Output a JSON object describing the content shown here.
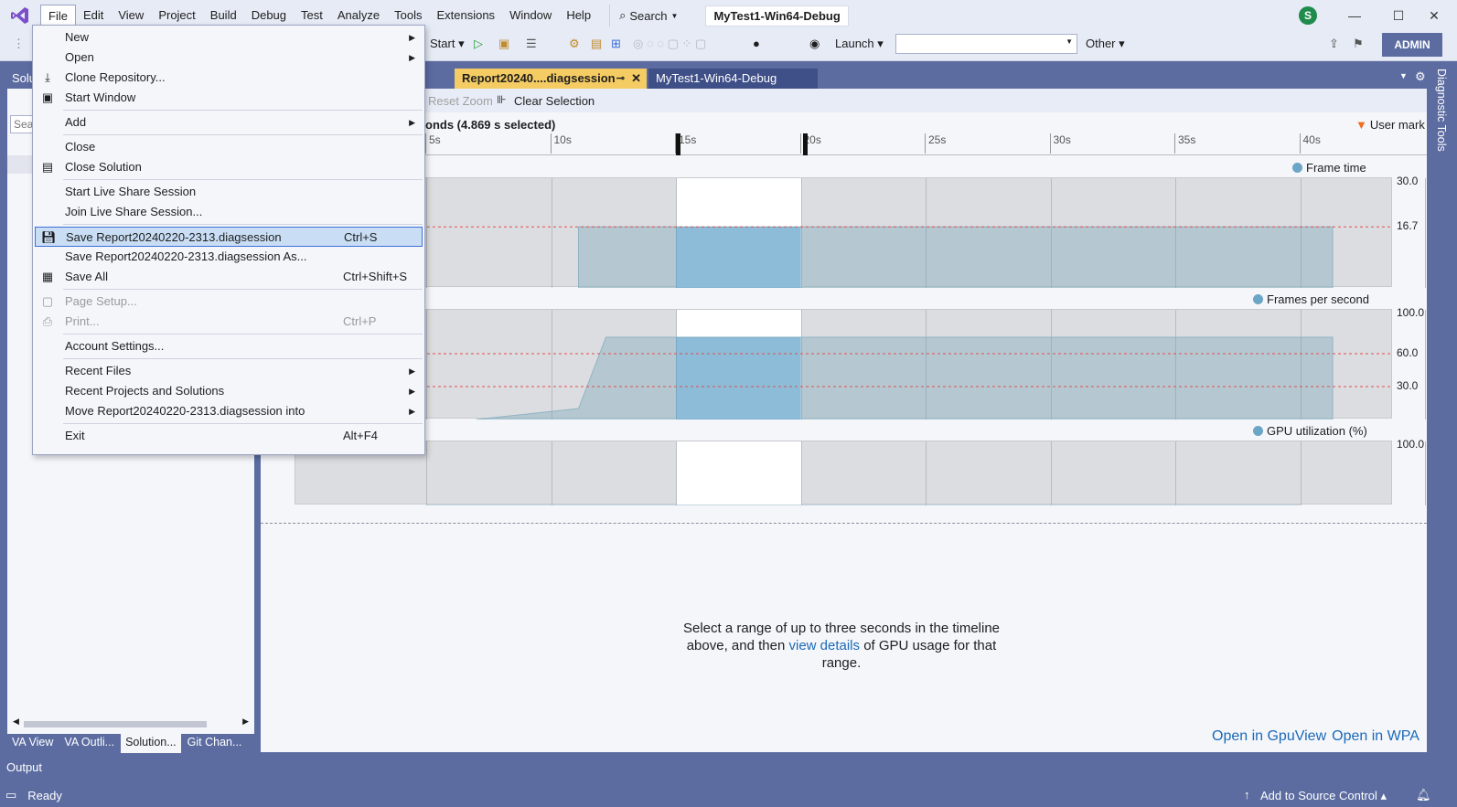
{
  "menubar": {
    "items": [
      "File",
      "Edit",
      "View",
      "Project",
      "Build",
      "Debug",
      "Test",
      "Analyze",
      "Tools",
      "Extensions",
      "Window",
      "Help"
    ],
    "search_label": "Search",
    "solution_name": "MyTest1-Win64-Debug",
    "avatar_letter": "S"
  },
  "toolbar": {
    "start_label": "Start",
    "launch_label": "Launch",
    "other_label": "Other",
    "admin_label": "ADMIN"
  },
  "left_panel": {
    "header": "Solu",
    "search_placeholder": "Sea",
    "bottom_tabs": [
      "VA View",
      "VA Outli...",
      "Solution...",
      "Git Chan..."
    ]
  },
  "output_label": "Output",
  "status": {
    "ready": "Ready",
    "source_control": "Add to Source Control"
  },
  "doc_tabs": [
    {
      "label": "Report20240....diagsession",
      "active": true
    },
    {
      "label": "MyTest1-Win64-Debug",
      "active": false
    }
  ],
  "diag_side_label": "Diagnostic Tools",
  "gpu_toolbar": {
    "reset_zoom": "Reset Zoom",
    "clear_selection": "Clear Selection"
  },
  "timeline": {
    "summary": "onds (4.869 s selected)",
    "user_mark": "User mark",
    "ticks": [
      "5s",
      "10s",
      "15s",
      "20s",
      "25s",
      "30s",
      "35s",
      "40s"
    ]
  },
  "chart_data": [
    {
      "type": "area",
      "title": "Frame time",
      "y_labels": [
        "30.0",
        "16.7"
      ],
      "ylim": [
        0,
        30
      ],
      "x": [
        5,
        10,
        11.1,
        15,
        20,
        25,
        30,
        35,
        41.3
      ],
      "values": [
        null,
        null,
        16.7,
        16.7,
        16.7,
        16.7,
        16.7,
        16.7,
        16.7
      ],
      "reference_line": 16.7
    },
    {
      "type": "area",
      "title": "Frames per second",
      "y_labels": [
        "100.0",
        "60.0",
        "30.0"
      ],
      "ylim": [
        0,
        100
      ],
      "x": [
        7,
        11.1,
        12.2,
        15,
        20,
        25,
        30,
        35,
        41.3
      ],
      "values": [
        0,
        10,
        75,
        75,
        75,
        75,
        75,
        75,
        75
      ],
      "reference_lines": [
        60,
        30
      ]
    },
    {
      "type": "area",
      "title": "GPU utilization (%)",
      "y_labels": [
        "100.0"
      ],
      "ylim": [
        0,
        100
      ],
      "x": [
        5,
        10,
        15,
        20,
        25,
        30,
        35,
        40
      ],
      "values": [
        0,
        0,
        0,
        0,
        0,
        0,
        0,
        0
      ]
    }
  ],
  "empty_message": {
    "pre": "Select a range of up to three seconds in the timeline above, and then ",
    "link": "view details",
    "post": " of GPU usage for that range."
  },
  "bottom_links": [
    "Open in GpuView",
    "Open in WPA"
  ],
  "file_menu": {
    "items": [
      {
        "label": "New",
        "submenu": true
      },
      {
        "label": "Open",
        "submenu": true
      },
      {
        "label": "Clone Repository...",
        "icon": "clone-icon"
      },
      {
        "label": "Start Window",
        "icon": "start-window-icon"
      },
      {
        "label": "Add",
        "submenu": true
      },
      {
        "label": "Close"
      },
      {
        "label": "Close Solution",
        "icon": "close-solution-icon"
      },
      {
        "label": "Start Live Share Session"
      },
      {
        "label": "Join Live Share Session..."
      },
      {
        "label": "Save Report20240220-2313.diagsession",
        "shortcut": "Ctrl+S",
        "highlighted": true,
        "icon": "save-icon"
      },
      {
        "label": "Save Report20240220-2313.diagsession As..."
      },
      {
        "label": "Save All",
        "shortcut": "Ctrl+Shift+S",
        "icon": "save-all-icon"
      },
      {
        "label": "Page Setup...",
        "disabled": true,
        "icon": "page-setup-icon"
      },
      {
        "label": "Print...",
        "shortcut": "Ctrl+P",
        "disabled": true,
        "icon": "print-icon"
      },
      {
        "label": "Account Settings..."
      },
      {
        "label": "Recent Files",
        "submenu": true
      },
      {
        "label": "Recent Projects and Solutions",
        "submenu": true
      },
      {
        "label": "Move Report20240220-2313.diagsession into",
        "submenu": true
      },
      {
        "label": "Exit",
        "shortcut": "Alt+F4"
      }
    ]
  }
}
